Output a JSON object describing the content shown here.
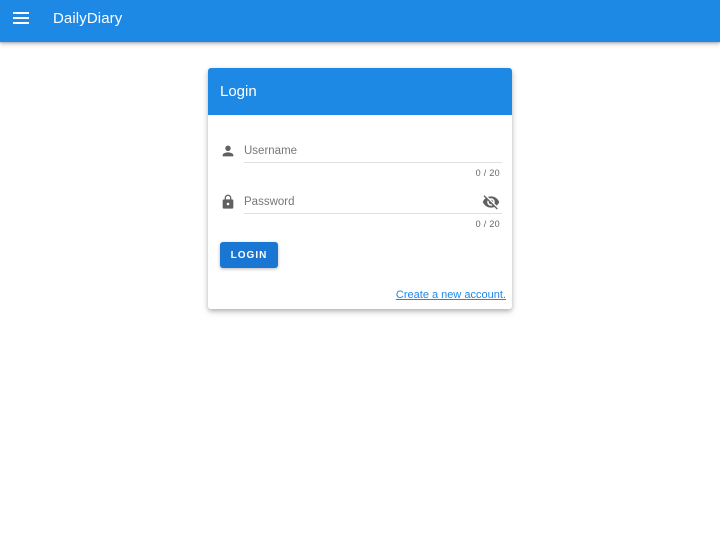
{
  "app": {
    "title": "DailyDiary",
    "menu_icon": "menu-icon"
  },
  "login_card": {
    "title": "Login",
    "username": {
      "icon": "person-icon",
      "placeholder": "Username",
      "value": "",
      "counter": "0 / 20"
    },
    "password": {
      "icon": "lock-icon",
      "placeholder": "Password",
      "value": "",
      "counter": "0 / 20",
      "toggle_icon": "eye-off-icon"
    },
    "login_button": "LOGIN",
    "create_account_link": "Create a new account."
  },
  "colors": {
    "primary": "#1e88e5",
    "button": "#1976d2",
    "icon": "#616161"
  }
}
